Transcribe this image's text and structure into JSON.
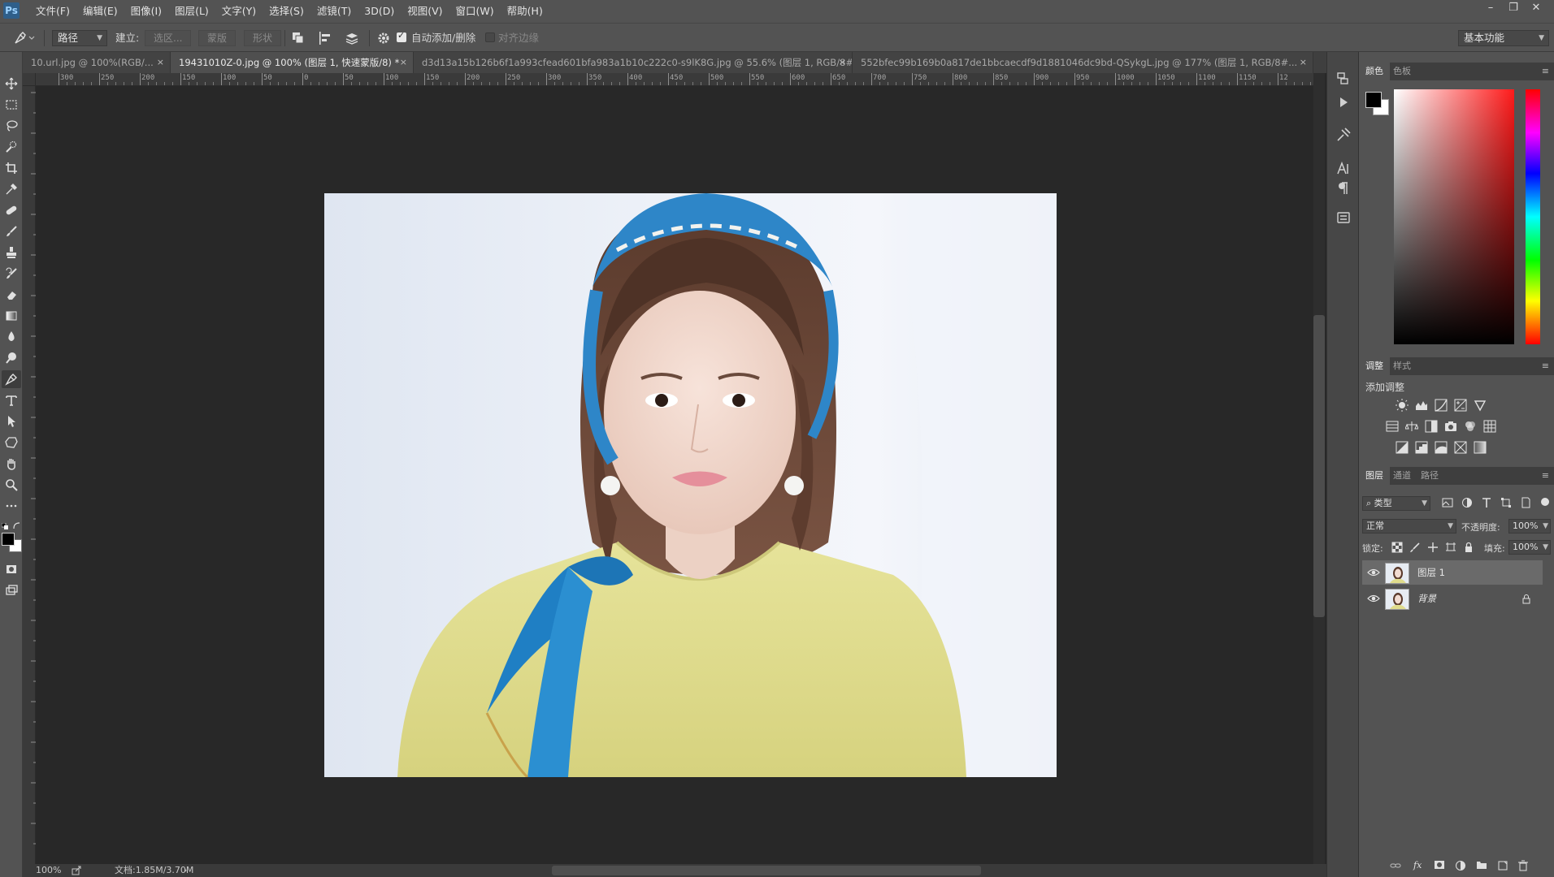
{
  "app": {
    "logo": "Ps"
  },
  "menu": [
    "文件(F)",
    "编辑(E)",
    "图像(I)",
    "图层(L)",
    "文字(Y)",
    "选择(S)",
    "滤镜(T)",
    "3D(D)",
    "视图(V)",
    "窗口(W)",
    "帮助(H)"
  ],
  "window_controls": {
    "minimize": "–",
    "restore": "❐",
    "close": "✕"
  },
  "options": {
    "tool_mode": "路径",
    "make_label": "建立:",
    "selection_btn": "选区...",
    "mask_btn": "蒙版",
    "shape_btn": "形状",
    "auto_add_delete": "自动添加/删除",
    "auto_add_delete_checked": true,
    "align_edges": "对齐边缘",
    "align_edges_checked": false,
    "workspace": "基本功能"
  },
  "tabs": [
    {
      "label": "10.url.jpg @ 100%(RGB/...",
      "active": false
    },
    {
      "label": "19431010Z-0.jpg @ 100% (图层 1, 快速蒙版/8) *",
      "active": true
    },
    {
      "label": "d3d13a15b126b6f1a993cfead601bfa983a1b10c222c0-s9lK8G.jpg @ 55.6% (图层 1, RGB/8#...",
      "active": false
    },
    {
      "label": "552bfec99b169b0a817de1bbcaecdf9d1881046dc9bd-QSykgL.jpg @ 177% (图层 1, RGB/8#...",
      "active": false
    }
  ],
  "tab_close": "×",
  "ruler_h": [
    "300",
    "250",
    "200",
    "150",
    "100",
    "50",
    "0",
    "50",
    "100",
    "150",
    "200",
    "250",
    "300",
    "350",
    "400",
    "450",
    "500",
    "550",
    "600",
    "650",
    "700",
    "750",
    "800",
    "850",
    "900",
    "950",
    "1000",
    "1050",
    "1100",
    "1150",
    "12"
  ],
  "status": {
    "zoom": "100%",
    "doc": "文档:1.85M/3.70M",
    "arrow": "›"
  },
  "panels": {
    "color_tabs": [
      "颜色",
      "色板"
    ],
    "adjust_tabs": [
      "调整",
      "样式"
    ],
    "adjust_title": "添加调整",
    "layers_tabs": [
      "图层",
      "通道",
      "路径"
    ],
    "kind_filter": "类型",
    "blend_mode": "正常",
    "opacity_label": "不透明度:",
    "opacity_value": "100%",
    "lock_label": "锁定:",
    "fill_label": "填充:",
    "fill_value": "100%",
    "menu_icon": "≡"
  },
  "layers": [
    {
      "name": "图层 1",
      "selected": true,
      "locked": false
    },
    {
      "name": "背景",
      "selected": false,
      "locked": true
    }
  ],
  "colors": {
    "foreground": "#000000",
    "background": "#ffffff",
    "ui_bg": "#535353",
    "canvas_bg": "#282828"
  }
}
